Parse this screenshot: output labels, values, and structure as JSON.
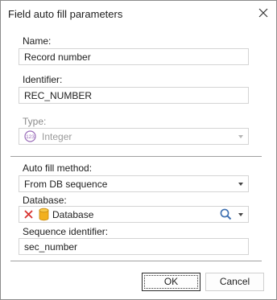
{
  "dialog": {
    "title": "Field auto fill parameters"
  },
  "name": {
    "label": "Name:",
    "value": "Record number"
  },
  "identifier": {
    "label": "Identifier:",
    "value": "REC_NUMBER"
  },
  "type": {
    "label": "Type:",
    "value": "Integer",
    "icon_text": "123",
    "icon": "integer-type-icon"
  },
  "auto_fill": {
    "label": "Auto fill method:",
    "value": "From DB sequence"
  },
  "database": {
    "label": "Database:",
    "value": "Database"
  },
  "sequence": {
    "label": "Sequence identifier:",
    "value": "sec_number"
  },
  "buttons": {
    "ok": "OK",
    "cancel": "Cancel"
  },
  "colors": {
    "clear_red": "#d8322f",
    "database_yellow": "#f2b01e",
    "type_icon_purple": "#9a6cb9",
    "search_blue": "#3d6fb0"
  }
}
